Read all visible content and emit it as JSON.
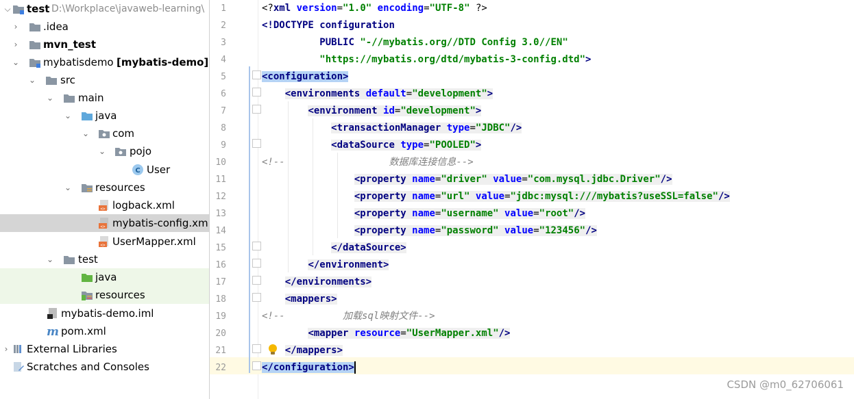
{
  "colors": {
    "tag": "#000080",
    "attribute": "#0000ff",
    "value": "#008000",
    "comment": "#808080",
    "selected_row": "#d5d5d5",
    "current_line": "#fffae3",
    "tag_match": "#b5d3f5",
    "test_source_row": "#eef7e8"
  },
  "project_tree": {
    "root": {
      "label": "test",
      "path": "D:\\Workplace\\javaweb-learning\\"
    },
    "items": [
      {
        "label": "test",
        "icon": "module-folder-icon"
      },
      {
        "label": ".idea",
        "icon": "folder-icon"
      },
      {
        "label": "mvn_test",
        "icon": "module-folder-icon"
      },
      {
        "label": "mybatisdemo",
        "suffix": "[mybatis-demo]",
        "icon": "module-folder-icon"
      },
      {
        "label": "src",
        "icon": "folder-icon"
      },
      {
        "label": "main",
        "icon": "folder-icon"
      },
      {
        "label": "java",
        "icon": "source-folder-icon"
      },
      {
        "label": "com",
        "icon": "package-icon"
      },
      {
        "label": "pojo",
        "icon": "package-icon"
      },
      {
        "label": "User",
        "icon": "class-icon"
      },
      {
        "label": "resources",
        "icon": "resources-folder-icon"
      },
      {
        "label": "logback.xml",
        "icon": "xml-file-icon"
      },
      {
        "label": "mybatis-config.xml",
        "icon": "xml-file-icon"
      },
      {
        "label": "UserMapper.xml",
        "icon": "xml-file-icon"
      },
      {
        "label": "test",
        "icon": "folder-icon"
      },
      {
        "label": "java",
        "icon": "test-source-folder-icon"
      },
      {
        "label": "resources",
        "icon": "test-resources-folder-icon"
      },
      {
        "label": "mybatis-demo.iml",
        "icon": "iml-file-icon"
      },
      {
        "label": "pom.xml",
        "icon": "maven-icon"
      },
      {
        "label": "External Libraries",
        "icon": "libraries-icon"
      },
      {
        "label": "Scratches and Consoles",
        "icon": "scratches-icon"
      }
    ]
  },
  "editor": {
    "line_numbers": [
      "1",
      "2",
      "3",
      "4",
      "5",
      "6",
      "7",
      "8",
      "9",
      "10",
      "11",
      "12",
      "13",
      "14",
      "15",
      "16",
      "17",
      "18",
      "19",
      "20",
      "21",
      "22"
    ],
    "tokens": {
      "l1_decl_open": "<?",
      "l1_xml": "xml",
      "l1_version_attr": "version",
      "l1_version_val": "\"1.0\"",
      "l1_encoding_attr": "encoding",
      "l1_encoding_val": "\"UTF-8\"",
      "l1_decl_close": "?>",
      "l2_doctype": "<!DOCTYPE",
      "l2_config": "configuration",
      "l3_public": "PUBLIC",
      "l3_public_id": "\"-//mybatis.org//DTD Config 3.0//EN\"",
      "l4_system_id": "\"https://mybatis.org/dtd/mybatis-3-config.dtd\"",
      "l4_close": ">",
      "l5": "<configuration>",
      "l6_tag": "<environments",
      "l6_attr": "default",
      "l6_val": "\"development\"",
      "l6_close": ">",
      "l7_tag": "<environment",
      "l7_attr": "id",
      "l7_val": "\"development\"",
      "l7_close": ">",
      "l8_tag": "<transactionManager",
      "l8_attr": "type",
      "l8_val": "\"JDBC\"",
      "l8_close": "/>",
      "l9_tag": "<dataSource",
      "l9_attr": "type",
      "l9_val": "\"POOLED\"",
      "l9_close": ">",
      "l10_open": "<!--",
      "l10_text": "数据库连接信息-->",
      "l11_tag": "<property",
      "l11_name_attr": "name",
      "l11_name_val": "\"driver\"",
      "l11_value_attr": "value",
      "l11_value_val": "\"com.mysql.jdbc.Driver\"",
      "l11_close": "/>",
      "l12_tag": "<property",
      "l12_name_attr": "name",
      "l12_name_val": "\"url\"",
      "l12_value_attr": "value",
      "l12_value_val": "\"jdbc:mysql:///mybatis?useSSL=false\"",
      "l12_close": "/>",
      "l13_tag": "<property",
      "l13_name_attr": "name",
      "l13_name_val": "\"username\"",
      "l13_value_attr": "value",
      "l13_value_val": "\"root\"",
      "l13_close": "/>",
      "l14_tag": "<property",
      "l14_name_attr": "name",
      "l14_name_val": "\"password\"",
      "l14_value_attr": "value",
      "l14_value_val": "\"123456\"",
      "l14_close": "/>",
      "l15": "</dataSource>",
      "l16": "</environment>",
      "l17": "</environments>",
      "l18": "<mappers>",
      "l19_open": "<!--",
      "l19_text": "加载sql映射文件-->",
      "l20_tag": "<mapper",
      "l20_attr": "resource",
      "l20_val": "\"UserMapper.xml\"",
      "l20_close": "/>",
      "l21": "</mappers>",
      "l22": "</configuration>"
    }
  },
  "watermark": "CSDN @m0_62706061"
}
